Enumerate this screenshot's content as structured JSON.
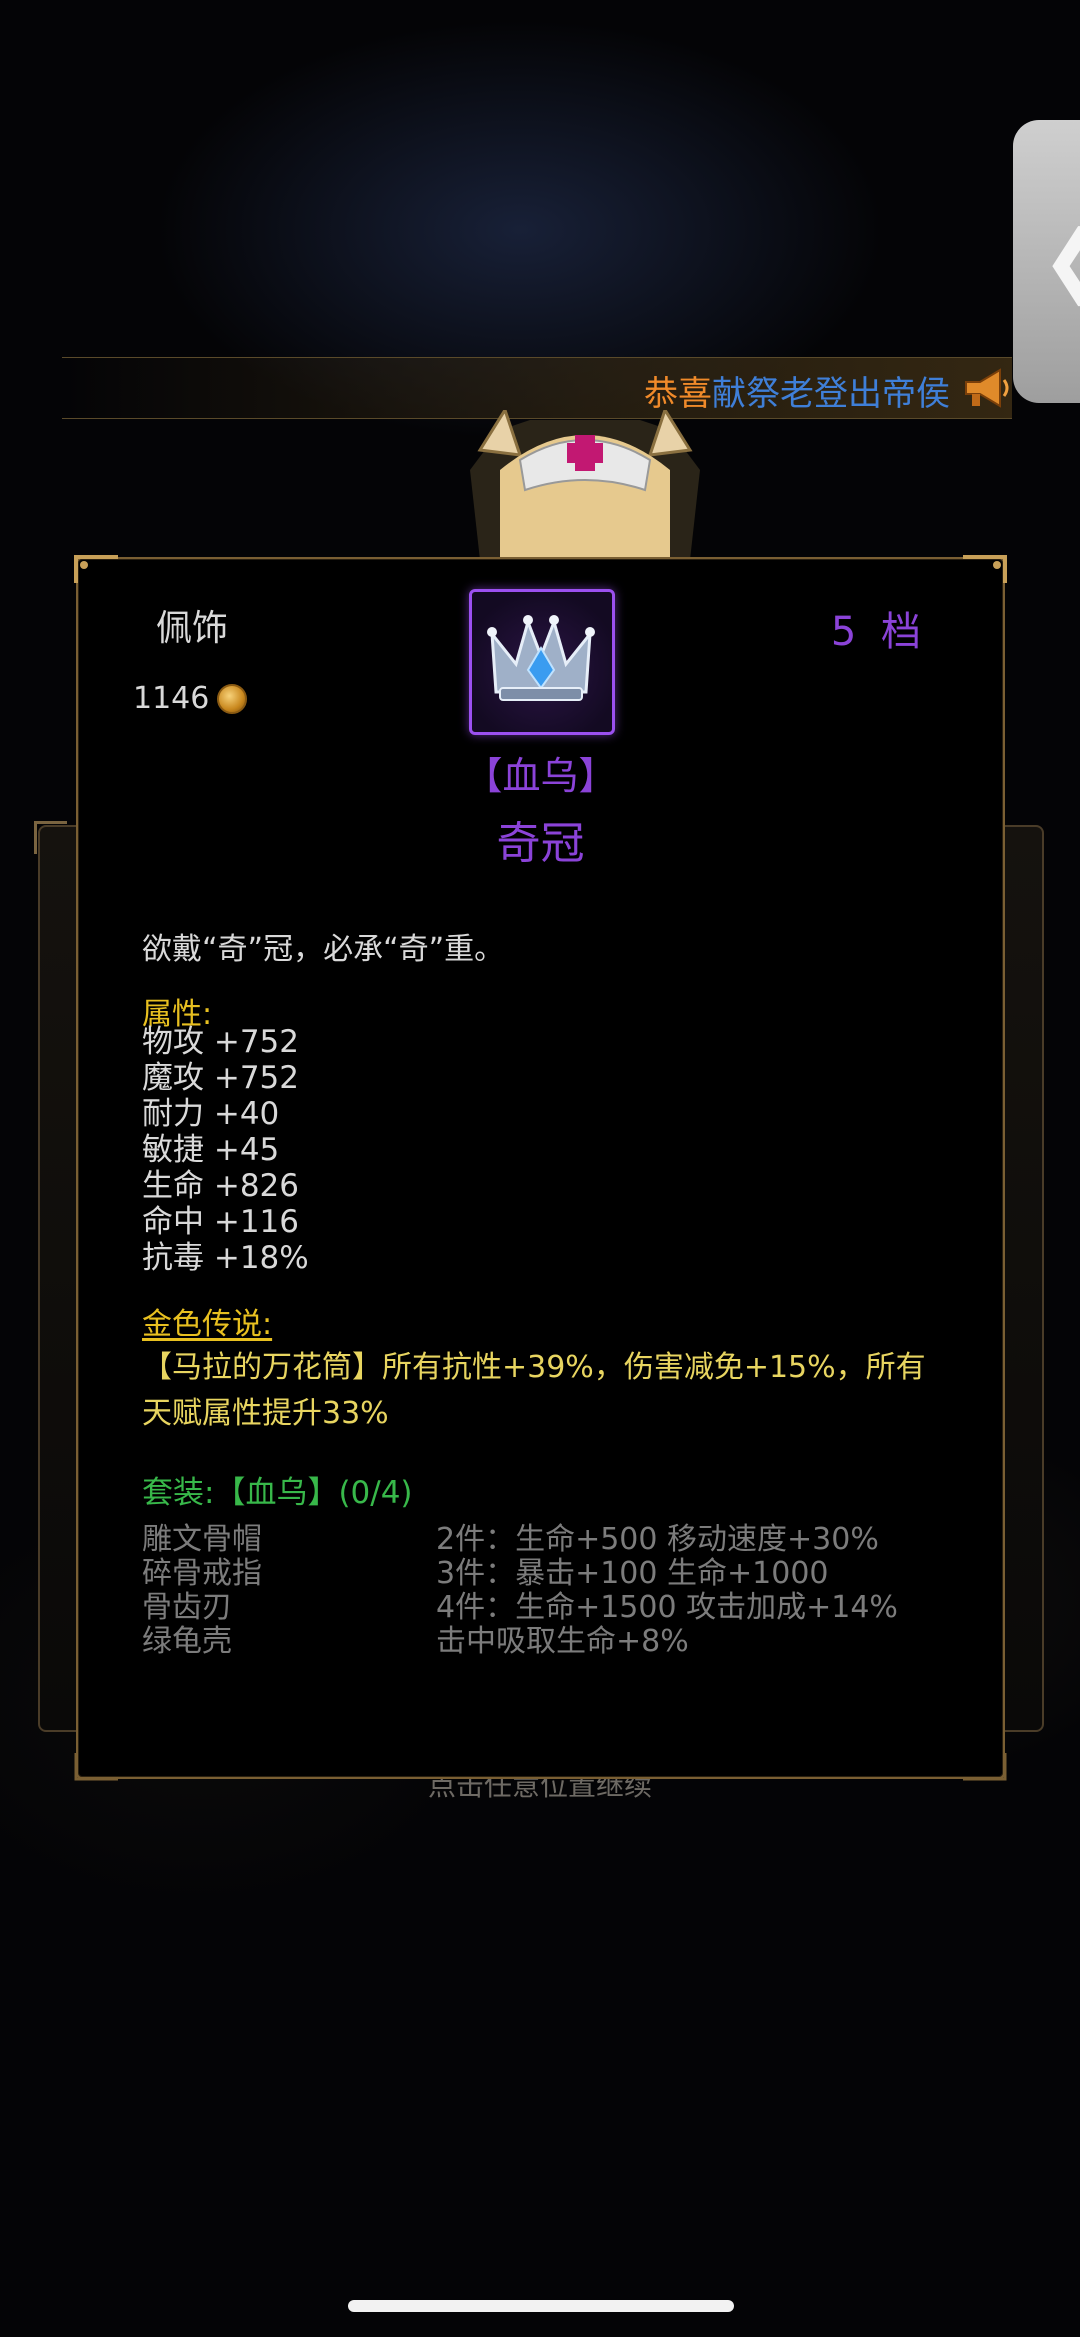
{
  "announcement": {
    "prefix": "恭喜",
    "player": "献祭老登出帝侯"
  },
  "side_tab": {
    "arrow": "❮"
  },
  "background_hint": "点击任意位置继续",
  "item": {
    "slot_label": "佩饰",
    "price": "1146",
    "tier": "5 档",
    "icon": "crown-icon",
    "set_name": "【血乌】",
    "name": "奇冠",
    "flavor": "欲戴“奇”冠，必承“奇”重。",
    "attributes_title": "属性:",
    "attributes": [
      "物攻 +752",
      "魔攻 +752",
      "耐力 +40",
      "敏捷 +45",
      "生命 +826",
      "命中 +116",
      "抗毒 +18%"
    ],
    "legend_title": "金色传说:",
    "legend_text": "【马拉的万花筒】所有抗性+39%，伤害减免+15%，所有天赋属性提升33%",
    "set_title": "套装:【血乌】(0/4)",
    "set_items": [
      "雕文骨帽",
      "碎骨戒指",
      "骨齿刃",
      "绿龟壳"
    ],
    "set_bonuses": [
      "2件：生命+500 移动速度+30%",
      "3件：暴击+100 生命+1000",
      "4件：生命+1500 攻击加成+14%",
      "击中吸取生命+8%"
    ]
  },
  "colors": {
    "purple": "#8b43d8",
    "gold": "#e8c020",
    "green": "#38b84a",
    "grey": "#7c7c7c"
  }
}
